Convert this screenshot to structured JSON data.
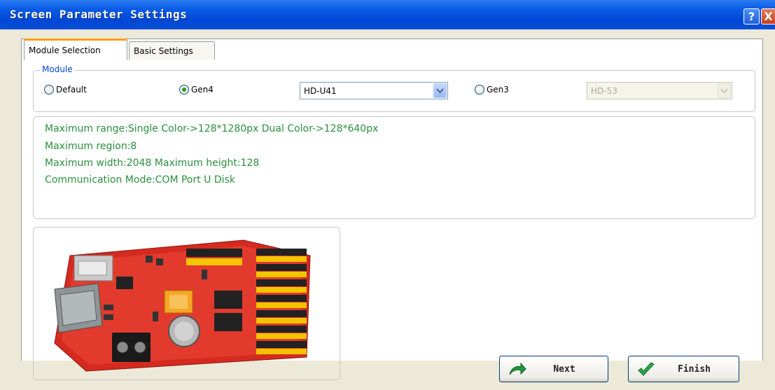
{
  "window": {
    "title": "Screen Parameter Settings",
    "help_label": "?",
    "close_label": "X"
  },
  "tabs": [
    {
      "label": "Module Selection",
      "active": true
    },
    {
      "label": "Basic Settings",
      "active": false
    }
  ],
  "module": {
    "group_label": "Module",
    "options": {
      "default": {
        "label": "Default",
        "checked": false
      },
      "gen4": {
        "label": "Gen4",
        "checked": true
      },
      "gen3": {
        "label": "Gen3",
        "checked": false
      }
    },
    "gen4_select_value": "HD-U41",
    "gen3_select_value": "HD-53"
  },
  "info": {
    "lines": [
      "Maximum range:Single Color->128*1280px  Dual Color->128*640px",
      "Maximum region:8",
      "Maximum width:2048 Maximum height:128",
      "Communication Mode:COM Port  U Disk"
    ],
    "text_color": "#2b8f3c"
  },
  "image": {
    "icon": "controller-board-photo"
  },
  "buttons": {
    "next_label": "Next",
    "finish_label": "Finish",
    "next_icon": "curved-arrow-icon",
    "finish_icon": "checkmark-icon"
  },
  "colors": {
    "titlebar": "#0a5ce6",
    "active_tab_accent": "#ff9c1a",
    "legend": "#0046d5"
  }
}
